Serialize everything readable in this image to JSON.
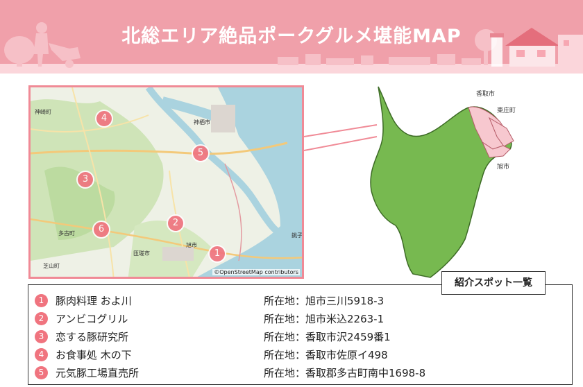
{
  "banner": {
    "title": "北総エリア絶品ポークグルメ堪能MAP"
  },
  "map": {
    "attribution": "©OpenStreetMap contributors",
    "pins": [
      {
        "number": "1"
      },
      {
        "number": "2"
      },
      {
        "number": "3"
      },
      {
        "number": "4"
      },
      {
        "number": "5"
      },
      {
        "number": "6"
      }
    ],
    "places": [
      "神栖市",
      "旭市",
      "匝瑳市",
      "多古町",
      "銚子",
      "芝山町",
      "神崎町"
    ]
  },
  "prefecture_map": {
    "labels": [
      "香取市",
      "東庄町",
      "旭市"
    ],
    "colors": {
      "prefecture": "#77b950",
      "highlight": "#f7c8cf",
      "outline": "#3c6a25"
    }
  },
  "spot_list": {
    "header": "紹介スポット一覧",
    "items": [
      {
        "number": "1",
        "name": "豚肉料理 およ川",
        "address": "所在地：旭市三川5918-3"
      },
      {
        "number": "2",
        "name": "アンビコグリル",
        "address": "所在地：旭市米込2263-1"
      },
      {
        "number": "3",
        "name": "恋する豚研究所",
        "address": "所在地：香取市沢2459番1"
      },
      {
        "number": "4",
        "name": "お食事処 木の下",
        "address": "所在地：香取市佐原イ498"
      },
      {
        "number": "5",
        "name": "元気豚工場直売所",
        "address": "所在地：香取郡多古町南中1698-8"
      }
    ]
  },
  "colors": {
    "banner": "#f0a0aa",
    "pin": "#f0747f",
    "frame": "#f08a96"
  }
}
